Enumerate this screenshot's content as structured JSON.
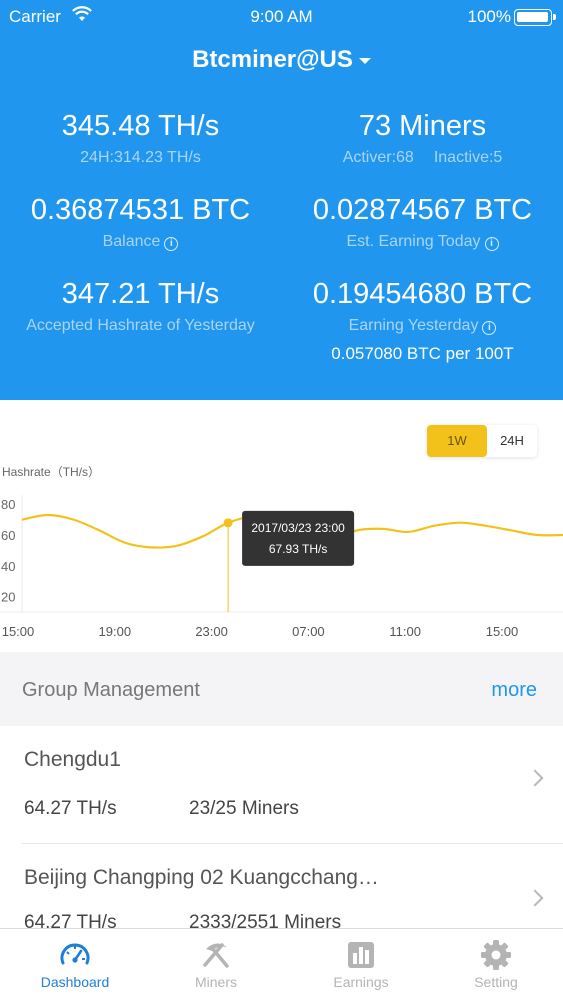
{
  "status_bar": {
    "carrier": "Carrier",
    "time": "9:00 AM",
    "battery": "100%"
  },
  "account": {
    "name": "Btcminer@US"
  },
  "stats": {
    "hashrate": {
      "value": "345.48 TH/s",
      "sub": "24H:314.23 TH/s"
    },
    "miners": {
      "value": "73 Miners",
      "active": "Activer:68",
      "inactive": "Inactive:5"
    },
    "balance": {
      "value": "0.36874531 BTC",
      "label": "Balance"
    },
    "est_today": {
      "value": "0.02874567 BTC",
      "label": "Est. Earning Today"
    },
    "accepted": {
      "value": "347.21 TH/s",
      "label": "Accepted Hashrate of Yesterday"
    },
    "earning_yesterday": {
      "value": "0.19454680 BTC",
      "label": "Earning Yesterday",
      "per": "0.057080 BTC per 100T"
    }
  },
  "chart_controls": {
    "range_1w": "1W",
    "range_24h": "24H",
    "selected": "1W"
  },
  "chart_data": {
    "type": "line",
    "ylabel": "Hashrate（TH/s）",
    "ylim": [
      10,
      86
    ],
    "y_ticks": [
      "80",
      "60",
      "40",
      "20"
    ],
    "y_tick_values": [
      80,
      60,
      40,
      20
    ],
    "x_ticks": [
      "15:00",
      "19:00",
      "23:00",
      "07:00",
      "11:00",
      "15:00"
    ],
    "series": [
      {
        "values": [
          [
            0,
            70
          ],
          [
            1,
            73
          ],
          [
            2,
            70
          ],
          [
            3,
            63
          ],
          [
            4,
            55
          ],
          [
            5,
            52
          ],
          [
            6,
            53
          ],
          [
            7,
            59
          ],
          [
            8,
            67.93
          ],
          [
            9,
            72
          ],
          [
            10,
            69
          ],
          [
            11,
            58
          ],
          [
            12,
            57
          ],
          [
            13,
            63
          ],
          [
            14,
            64
          ],
          [
            15,
            62
          ],
          [
            16,
            66
          ],
          [
            17,
            68
          ],
          [
            18,
            66
          ],
          [
            19,
            63
          ],
          [
            20,
            60
          ],
          [
            21,
            60
          ]
        ]
      }
    ],
    "line_color": "#f2c21b",
    "tooltip": {
      "date": "2017/03/23 23:00",
      "value": "67.93 TH/s",
      "index": 8
    }
  },
  "groups": {
    "title": "Group Management",
    "more": "more",
    "items": [
      {
        "name": "Chengdu1",
        "rate": "64.27 TH/s",
        "miners": "23/25 Miners"
      },
      {
        "name": "Beijing Changping 02 Kuangcchang…",
        "rate": "64.27 TH/s",
        "miners": "2333/2551 Miners"
      }
    ]
  },
  "tabs": [
    {
      "label": "Dashboard",
      "icon": "gauge-icon",
      "active": true
    },
    {
      "label": "Miners",
      "icon": "pickaxe-icon",
      "active": false
    },
    {
      "label": "Earnings",
      "icon": "bar-chart-icon",
      "active": false
    },
    {
      "label": "Setting",
      "icon": "gear-icon",
      "active": false
    }
  ],
  "colors": {
    "header_bg": "#2196ee",
    "accent_yellow": "#f2c21b",
    "active_tab": "#1e7fd6"
  }
}
